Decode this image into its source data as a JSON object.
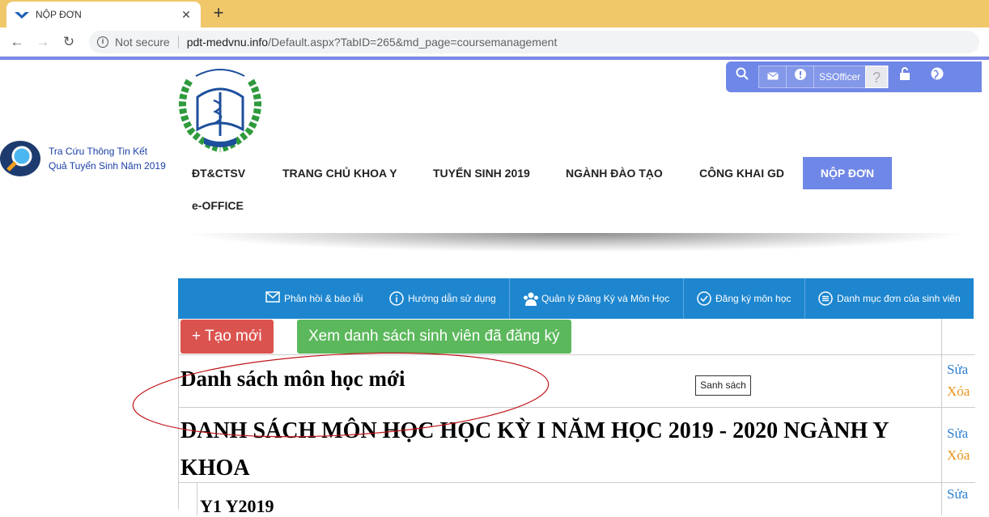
{
  "browser": {
    "tab_title": "NỘP ĐƠN",
    "tab_close": "✕",
    "new_tab": "+",
    "security": "Not secure",
    "url_host": "pdt-medvnu.info",
    "url_path": "/Default.aspx?TabID=265&md_page=coursemanagement"
  },
  "userbar": {
    "username": "SSOfficer"
  },
  "lookup": {
    "line1": "Tra Cứu Thông Tin Kết",
    "line2": "Quả Tuyển Sinh Năm 2019"
  },
  "menu": {
    "items": [
      "ĐT&CTSV",
      "TRANG CHỦ KHOA Y",
      "TUYỂN SINH 2019",
      "NGÀNH ĐÀO TẠO",
      "CÔNG KHAI GD",
      "NỘP ĐƠN",
      "e-OFFICE"
    ]
  },
  "bluenav": {
    "items": [
      "Phản hồi & báo lỗi",
      "Hướng dẫn sử dụng",
      "Quản lý Đăng Ký và Môn Học",
      "Đăng ký môn học",
      "Danh mục đơn của sinh viên"
    ]
  },
  "content": {
    "create_button": "+ Tạo mới",
    "view_button": "Xem danh sách sinh viên đã đăng ký",
    "tooltip": "Sanh sách",
    "rows": [
      {
        "title": "Danh sách môn học mới",
        "edit": "Sửa",
        "delete": "Xóa"
      },
      {
        "title_line1": "DANH SÁCH MÔN HỌC HỌC KỲ I NĂM HỌC 2019 - 2020 NGÀNH Y",
        "title_line2": "KHOA",
        "edit": "Sửa",
        "delete": "Xóa"
      },
      {
        "title": "Y1 Y2019",
        "edit": "Sửa"
      }
    ]
  },
  "colors": {
    "accent": "#6f87e6",
    "nav_blue": "#1e86cf",
    "danger": "#db534f",
    "success": "#5cb85c"
  }
}
